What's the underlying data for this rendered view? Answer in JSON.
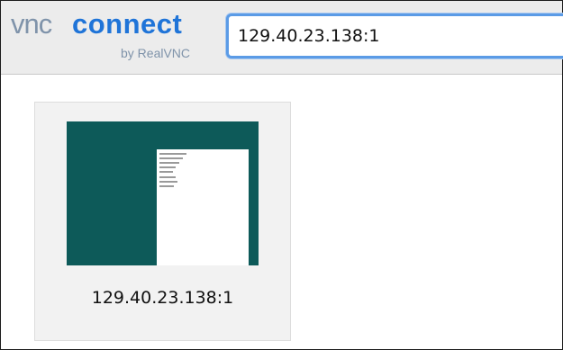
{
  "logo": {
    "vnc": "vnc",
    "connect": "connect",
    "byline": "by RealVNC"
  },
  "address_bar": {
    "value": "129.40.23.138:1",
    "placeholder": ""
  },
  "connections": [
    {
      "label": "129.40.23.138:1",
      "thumbnail": "remote-desktop-preview"
    }
  ],
  "colors": {
    "toolbar_bg": "#ececec",
    "logo_gray": "#7f93aa",
    "logo_blue": "#1f74d8",
    "focus_ring": "#5b9be6",
    "thumbnail_desktop": "#0d5a59",
    "tile_bg": "#f2f2f2"
  }
}
